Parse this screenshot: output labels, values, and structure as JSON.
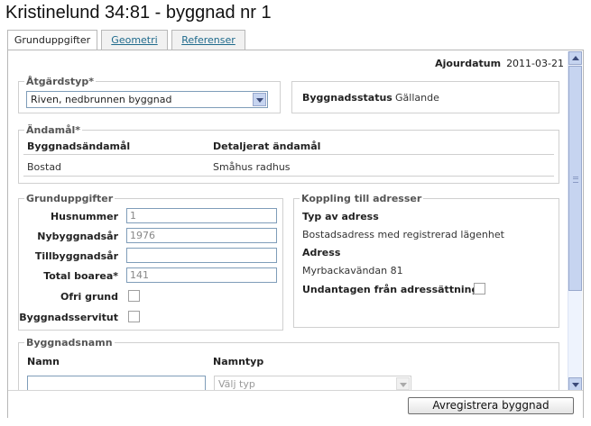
{
  "window": {
    "title": "Kristinelund 34:81 - byggnad nr 1"
  },
  "tabs": [
    {
      "label": "Grunduppgifter",
      "active": true
    },
    {
      "label": "Geometri",
      "active": false
    },
    {
      "label": "Referenser",
      "active": false
    }
  ],
  "ajour": {
    "label": "Ajourdatum",
    "value": "2011-03-21"
  },
  "atgard": {
    "legend": "Åtgärdstyp*",
    "selected": "Riven, nedbrunnen byggnad"
  },
  "status": {
    "label": "Byggnadsstatus",
    "value": "Gällande"
  },
  "andamal": {
    "legend": "Ändamål*",
    "headers": [
      "Byggnadsändamål",
      "Detaljerat ändamål"
    ],
    "rows": [
      [
        "Bostad",
        "Småhus radhus"
      ]
    ]
  },
  "grund": {
    "legend": "Grunduppgifter",
    "husnummer": {
      "label": "Husnummer",
      "value": "1"
    },
    "nybyggnadsar": {
      "label": "Nybyggnadsår",
      "value": "1976"
    },
    "tillbyggnadsar": {
      "label": "Tillbyggnadsår",
      "value": ""
    },
    "boarea": {
      "label": "Total boarea*",
      "value": "141"
    },
    "ofri": {
      "label": "Ofri grund",
      "checked": false
    },
    "servitut": {
      "label": "Byggnadsservitut",
      "checked": false
    }
  },
  "koppling": {
    "legend": "Koppling till adresser",
    "typ_label": "Typ av adress",
    "typ_value": "Bostadsadress med registrerad lägenhet",
    "adress_label": "Adress",
    "adress_value": "Myrbackavändan 81",
    "undantagen_label": "Undantagen från adressättning",
    "undantagen_checked": false
  },
  "namn": {
    "legend": "Byggnadsnamn",
    "namn_header": "Namn",
    "namntyp_header": "Namntyp",
    "namn_value": "",
    "namntyp_placeholder": "Välj typ"
  },
  "footer": {
    "button": "Avregistrera byggnad"
  },
  "colors": {
    "accent": "#1f6a8c",
    "border": "#b8b8b8",
    "scrollbar": "#c6d4f0"
  }
}
